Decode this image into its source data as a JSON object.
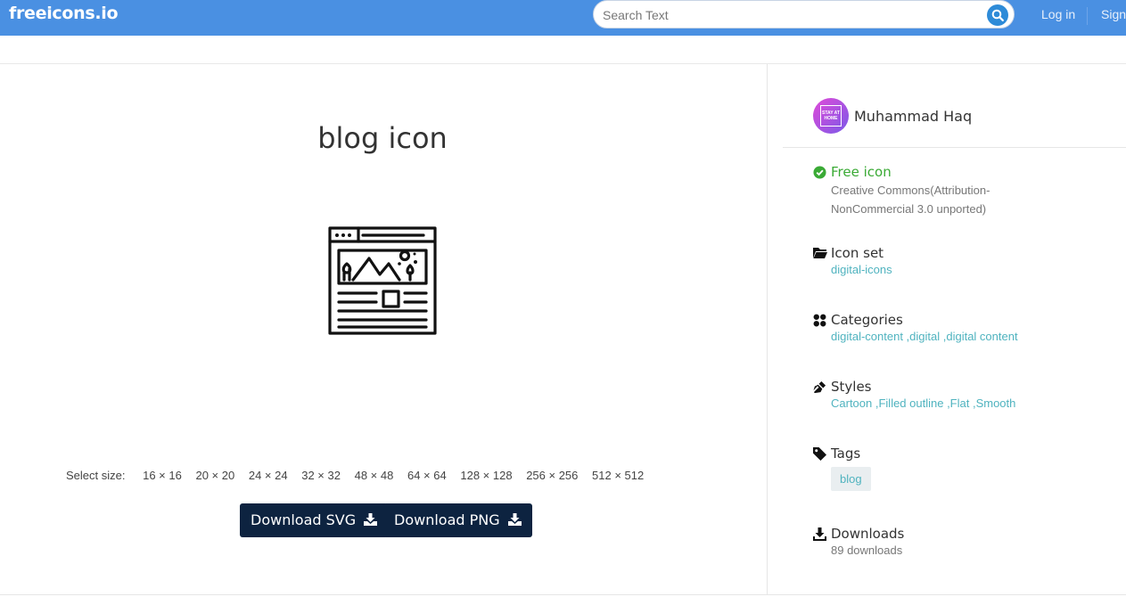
{
  "header": {
    "logo": "freeicons.io",
    "search_placeholder": "Search Text",
    "login_label": "Log in",
    "signup_label": "Sign"
  },
  "main": {
    "title": "blog icon",
    "select_size_label": "Select size:",
    "sizes": [
      "16 × 16",
      "20 × 20",
      "24 × 24",
      "32 × 32",
      "48 × 48",
      "64 × 64",
      "128 × 128",
      "256 × 256",
      "512 × 512"
    ],
    "download_svg_label": "Download SVG",
    "download_png_label": "Download PNG"
  },
  "sidebar": {
    "author_name": "Muhammad Haq",
    "avatar_text": "STAY AT HOME",
    "free": {
      "title": "Free icon",
      "license_line1": "Creative Commons(Attribution-",
      "license_line2": "NonCommercial 3.0 unported)"
    },
    "icon_set": {
      "title": "Icon set",
      "value": "digital-icons"
    },
    "categories": {
      "title": "Categories",
      "value": "digital-content ,digital ,digital content"
    },
    "styles": {
      "title": "Styles",
      "value": "Cartoon ,Filled outline ,Flat ,Smooth"
    },
    "tags": {
      "title": "Tags",
      "items": [
        "blog"
      ]
    },
    "downloads": {
      "title": "Downloads",
      "value": "89 downloads"
    }
  },
  "colors": {
    "topbar": "#4a90e2",
    "button_dark": "#0d2340",
    "link": "#4fb3bf",
    "free_green": "#3aaa35"
  },
  "icons": [
    "search-icon",
    "download-icon",
    "check-circle-icon",
    "folder-icon",
    "categories-icon",
    "pen-icon",
    "tag-icon",
    "blog-preview-icon"
  ]
}
